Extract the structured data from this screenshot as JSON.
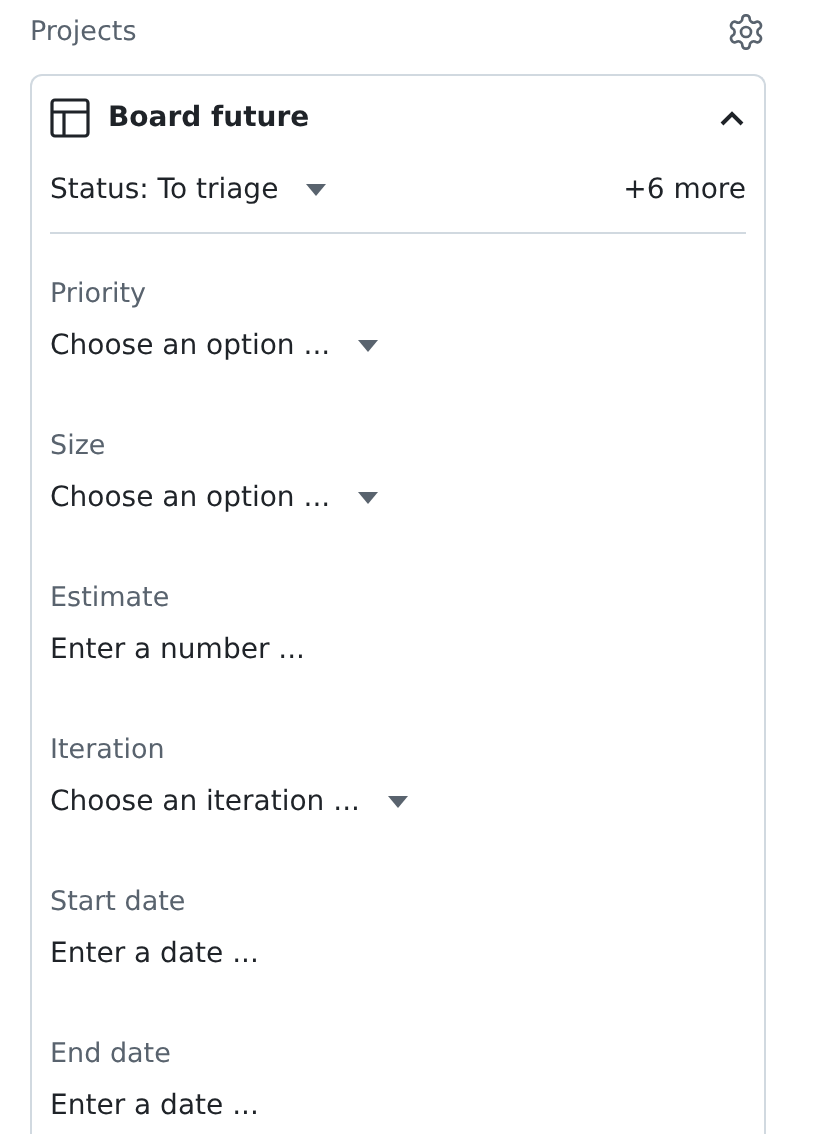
{
  "header": {
    "title": "Projects"
  },
  "project": {
    "name": "Board future",
    "expanded": true,
    "status": "Status: To triage",
    "more": "+6 more"
  },
  "fields": [
    {
      "label": "Priority",
      "kind": "select",
      "placeholder": "Choose an option ..."
    },
    {
      "label": "Size",
      "kind": "select",
      "placeholder": "Choose an option ..."
    },
    {
      "label": "Estimate",
      "kind": "input",
      "placeholder": "Enter a number ..."
    },
    {
      "label": "Iteration",
      "kind": "select",
      "placeholder": "Choose an iteration ..."
    },
    {
      "label": "Start date",
      "kind": "input",
      "placeholder": "Enter a date ..."
    },
    {
      "label": "End date",
      "kind": "input",
      "placeholder": "Enter a date ..."
    }
  ]
}
